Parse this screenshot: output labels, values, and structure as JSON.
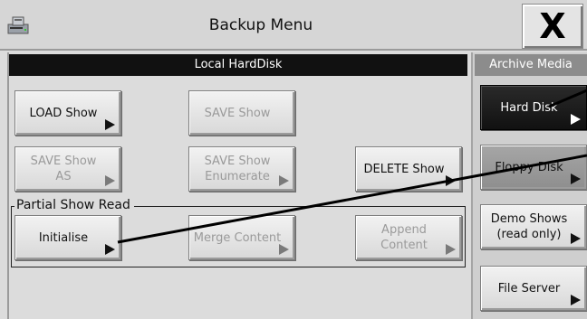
{
  "window": {
    "title": "Backup Menu",
    "close_label": "X"
  },
  "local": {
    "header": "Local HardDisk",
    "buttons": {
      "load": "LOAD Show",
      "save": "SAVE Show",
      "save_as": "SAVE Show\nAS",
      "save_enumerate": "SAVE Show\nEnumerate",
      "delete": "DELETE Show"
    },
    "partial": {
      "label": "Partial Show Read",
      "initialise": "Initialise",
      "merge": "Merge Content",
      "append": "Append Content"
    }
  },
  "archive": {
    "header": "Archive Media",
    "items": [
      {
        "label": "Hard Disk",
        "selected": true
      },
      {
        "label": "Floppy Disk",
        "selected": false
      },
      {
        "label": "Demo Shows\n(read only)",
        "selected": false
      },
      {
        "label": "File Server",
        "selected": false
      }
    ]
  }
}
